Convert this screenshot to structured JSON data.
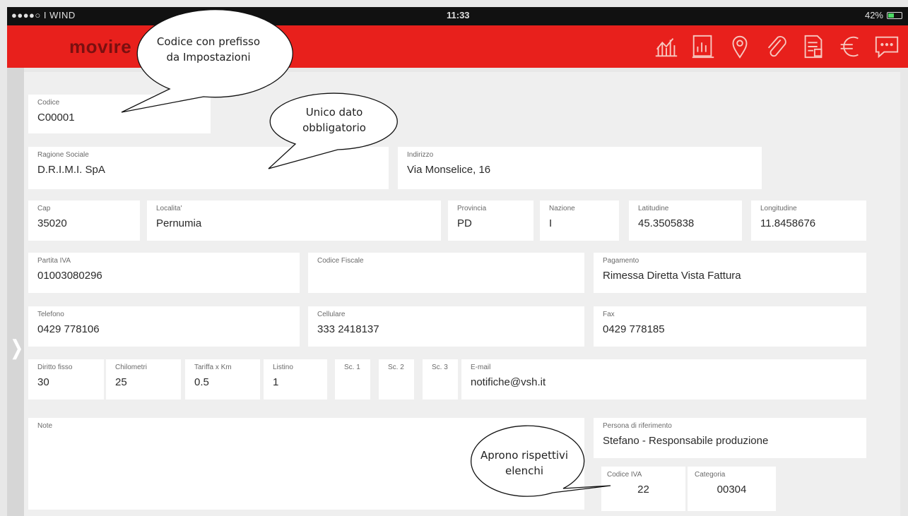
{
  "status_bar": {
    "carrier": "●●●●○ I WIND",
    "time": "11:33",
    "battery": "42%"
  },
  "app": {
    "title": "movire"
  },
  "toolbar": {
    "icons": [
      "chart-icon",
      "document-chart-icon",
      "location-pin-icon",
      "paperclip-icon",
      "report-icon",
      "euro-icon",
      "chat-icon"
    ]
  },
  "form": {
    "codice": {
      "label": "Codice",
      "value": "C00001"
    },
    "ragione_sociale": {
      "label": "Ragione Sociale",
      "value": "D.R.I.M.I. SpA"
    },
    "indirizzo": {
      "label": "Indirizzo",
      "value": "Via Monselice, 16"
    },
    "cap": {
      "label": "Cap",
      "value": "35020"
    },
    "localita": {
      "label": "Localita'",
      "value": "Pernumia"
    },
    "provincia": {
      "label": "Provincia",
      "value": "PD"
    },
    "nazione": {
      "label": "Nazione",
      "value": "I"
    },
    "latitudine": {
      "label": "Latitudine",
      "value": "45.3505838"
    },
    "longitudine": {
      "label": "Longitudine",
      "value": "11.8458676"
    },
    "partita_iva": {
      "label": "Partita IVA",
      "value": "01003080296"
    },
    "codice_fiscale": {
      "label": "Codice Fiscale",
      "value": ""
    },
    "pagamento": {
      "label": "Pagamento",
      "value": "Rimessa Diretta Vista Fattura"
    },
    "telefono": {
      "label": "Telefono",
      "value": "0429 778106"
    },
    "cellulare": {
      "label": "Cellulare",
      "value": "333 2418137"
    },
    "fax": {
      "label": "Fax",
      "value": "0429 778185"
    },
    "diritto_fisso": {
      "label": "Diritto fisso",
      "value": "30"
    },
    "chilometri": {
      "label": "Chilometri",
      "value": "25"
    },
    "tariffa_km": {
      "label": "Tariffa x Km",
      "value": "0.5"
    },
    "listino": {
      "label": "Listino",
      "value": "1"
    },
    "sc1": {
      "label": "Sc. 1",
      "value": ""
    },
    "sc2": {
      "label": "Sc. 2",
      "value": ""
    },
    "sc3": {
      "label": "Sc. 3",
      "value": ""
    },
    "email": {
      "label": "E-mail",
      "value": "notifiche@vsh.it"
    },
    "note": {
      "label": "Note",
      "value": ""
    },
    "persona_riferimento": {
      "label": "Persona di riferimento",
      "value": "Stefano - Responsabile produzione"
    },
    "codice_iva": {
      "label": "Codice IVA",
      "value": "22"
    },
    "categoria": {
      "label": "Categoria",
      "value": "00304"
    }
  },
  "callouts": {
    "codice": "Codice con prefisso da Impostazioni",
    "obbligatorio": "Unico dato obbligatorio",
    "elenchi": "Aprono rispettivi elenchi"
  },
  "colors": {
    "header": "#e8201c",
    "field_bg": "#ffffff",
    "form_bg": "#efefef"
  }
}
